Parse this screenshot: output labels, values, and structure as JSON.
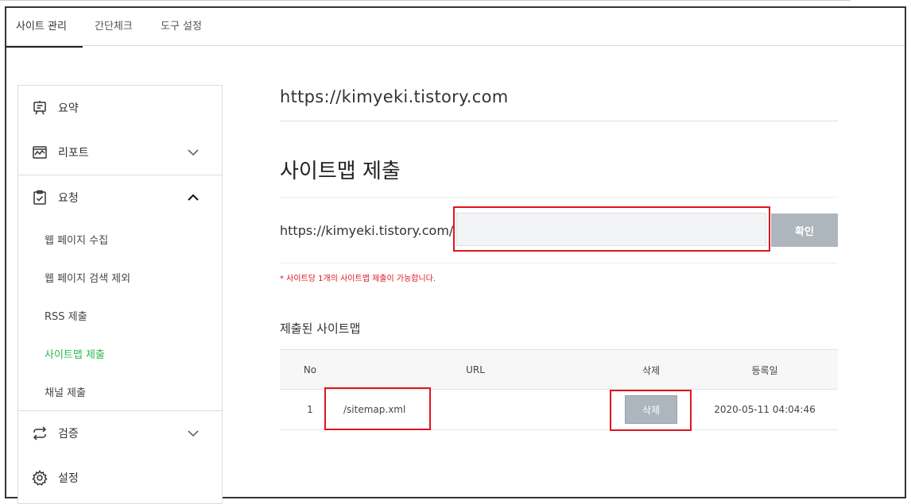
{
  "top_tabs": [
    {
      "label": "사이트 관리",
      "active": true
    },
    {
      "label": "간단체크",
      "active": false
    },
    {
      "label": "도구 설정",
      "active": false
    }
  ],
  "sidebar": {
    "groups": [
      {
        "label": "요약",
        "icon": "presentation-icon",
        "chevron": "none"
      },
      {
        "label": "리포트",
        "icon": "report-chart-icon",
        "chevron": "down"
      },
      {
        "label": "요청",
        "icon": "clipboard-check-icon",
        "chevron": "up",
        "items": [
          {
            "label": "웹 페이지 수집",
            "active": false
          },
          {
            "label": "웹 페이지 검색 제외",
            "active": false
          },
          {
            "label": "RSS 제출",
            "active": false
          },
          {
            "label": "사이트맵 제출",
            "active": true
          },
          {
            "label": "채널 제출",
            "active": false
          }
        ]
      },
      {
        "label": "검증",
        "icon": "swap-arrows-icon",
        "chevron": "down"
      },
      {
        "label": "설정",
        "icon": "gear-icon",
        "chevron": "none"
      }
    ]
  },
  "main": {
    "site_url": "https://kimyeki.tistory.com",
    "section_title": "사이트맵 제출",
    "url_prefix": "https://kimyeki.tistory.com/",
    "input_value": "",
    "input_placeholder": "",
    "confirm_label": "확인",
    "note": "* 사이트당 1개의 사이트맵 제출이 가능합니다.",
    "submitted_title": "제출된 사이트맵",
    "table": {
      "headers": {
        "no": "No",
        "url": "URL",
        "delete": "삭제",
        "date": "등록일"
      },
      "rows": [
        {
          "no": "1",
          "url": "/sitemap.xml",
          "delete_label": "삭제",
          "date": "2020-05-11 04:04:46"
        }
      ]
    }
  },
  "colors": {
    "accent_green": "#2db84d",
    "highlight_red": "#e0141e",
    "button_gray": "#adb5bd"
  }
}
